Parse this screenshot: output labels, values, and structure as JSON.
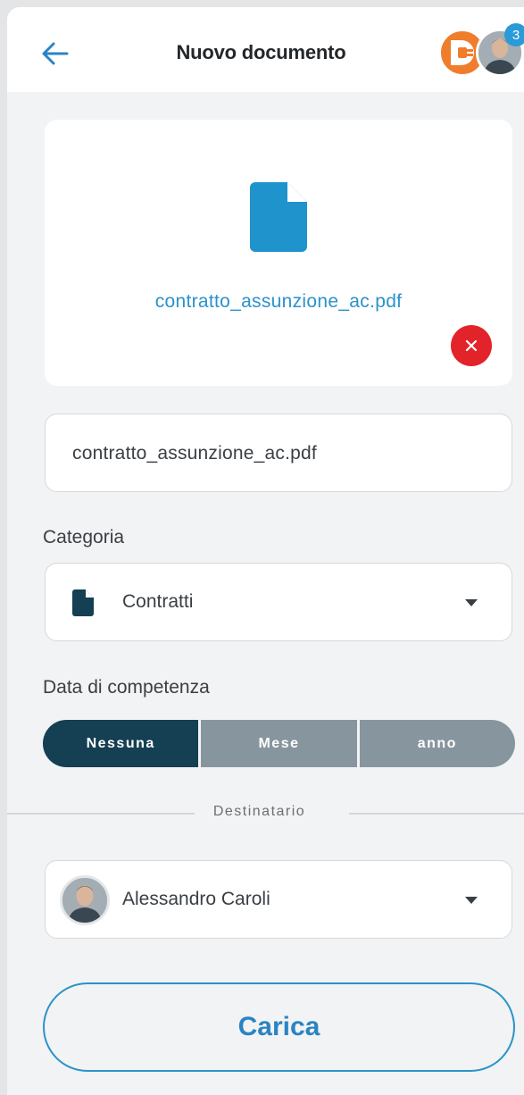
{
  "header": {
    "title": "Nuovo documento",
    "back_icon": "arrow-left-icon",
    "notification_count": "3"
  },
  "upload": {
    "file_name": "contratto_assunzione_ac.pdf",
    "file_icon": "document-icon",
    "remove_icon": "close-icon"
  },
  "form": {
    "document_name": "contratto_assunzione_ac.pdf",
    "category_label": "Categoria",
    "category_value": "Contratti",
    "date_label": "Data di competenza",
    "date_options": [
      "Nessuna",
      "Mese",
      "anno"
    ],
    "date_selected": "Nessuna",
    "recipient_section": "Destinatario",
    "recipient_name": "Alessandro Caroli",
    "submit_label": "Carica"
  },
  "colors": {
    "accent": "#2a93c9",
    "dark_segment": "#153f52",
    "inactive_segment": "#87959e",
    "remove": "#e2232a",
    "brand_logo": "#ef7d2c"
  }
}
